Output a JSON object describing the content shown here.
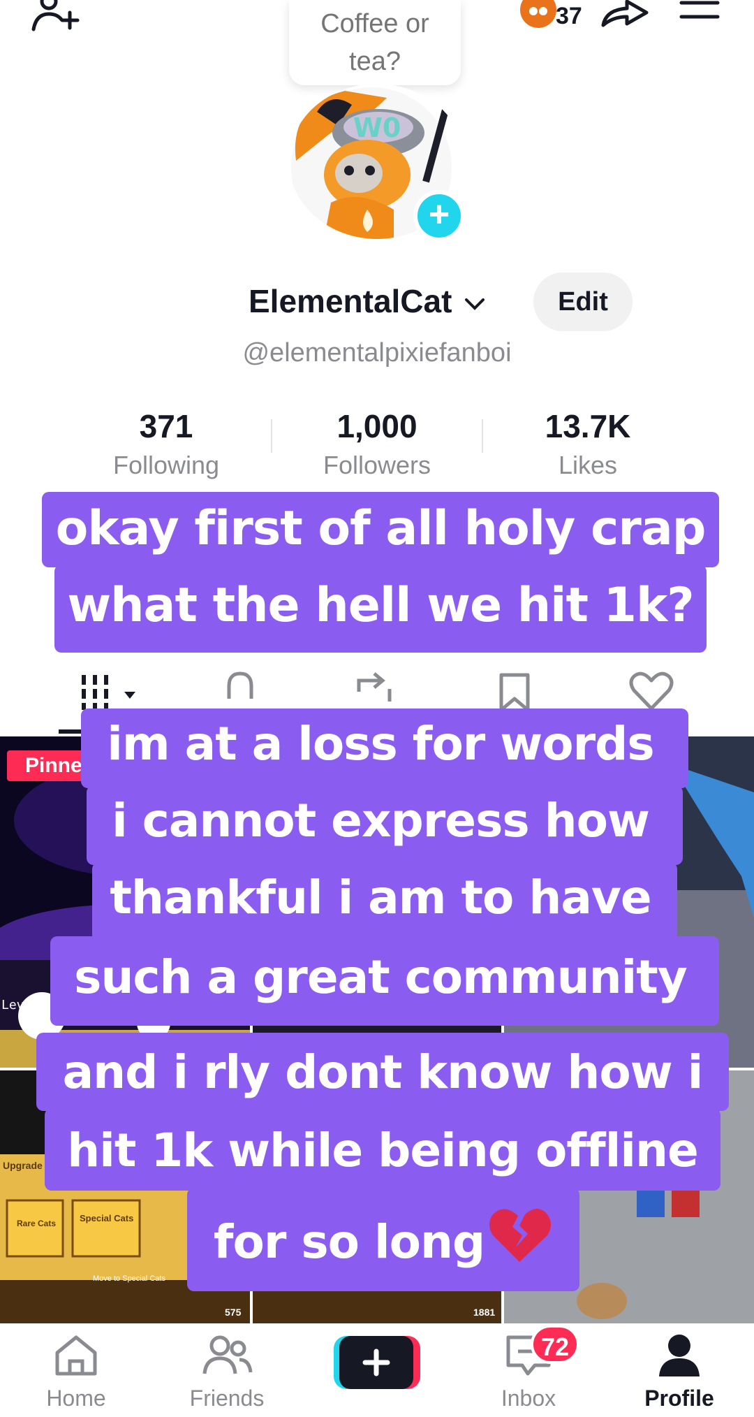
{
  "top_bar": {
    "bubble_text": "Coffee or tea?",
    "coin_count": "37"
  },
  "profile": {
    "display_name": "ElementalCat",
    "edit_label": "Edit",
    "handle": "@elementalpixiefanboi"
  },
  "stats": [
    {
      "value": "371",
      "label": "Following"
    },
    {
      "value": "1,000",
      "label": "Followers"
    },
    {
      "value": "13.7K",
      "label": "Likes"
    }
  ],
  "grid": {
    "pinned_label": "Pinned",
    "thumb_texts": {
      "level": "Level 8",
      "upgrade": "Upgrade",
      "rare_cats": "Rare Cats",
      "special_cats": "Special Cats",
      "move_to": "Move to Special Cats",
      "counter_a": "575",
      "counter_b": "1881"
    }
  },
  "captions": {
    "block1": [
      "okay first of all holy crap",
      "what the hell we hit 1k?"
    ],
    "block2": [
      "im at a loss for words",
      "i cannot express how",
      "thankful i am to have",
      "such a great community"
    ],
    "block3": [
      "and i rly dont know how i",
      "hit 1k while being offline",
      "for so long"
    ]
  },
  "bottom_nav": {
    "items": [
      {
        "label": "Home",
        "icon": "home-icon"
      },
      {
        "label": "Friends",
        "icon": "friends-icon"
      },
      {
        "label": "Inbox",
        "icon": "inbox-icon"
      },
      {
        "label": "Profile",
        "icon": "profile-icon"
      }
    ],
    "inbox_badge": "72"
  },
  "colors": {
    "caption_bg": "#8a5cf0",
    "accent_red": "#fe2c55",
    "accent_cyan": "#20d5ec"
  }
}
